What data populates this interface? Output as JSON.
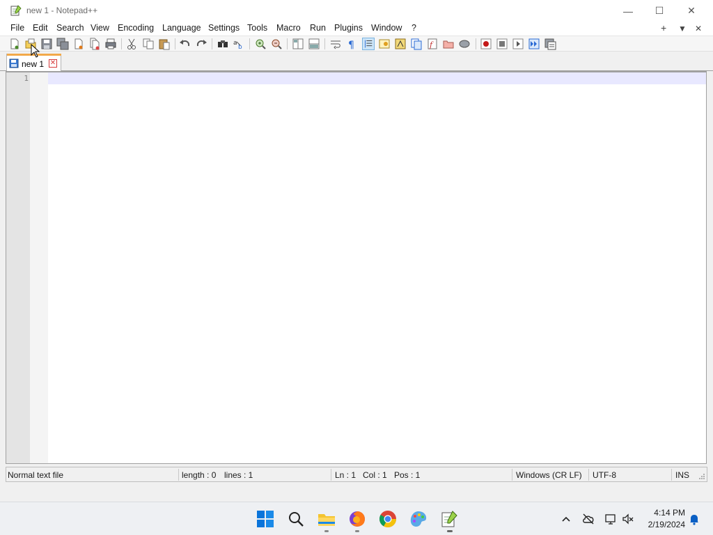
{
  "window": {
    "title": "new 1 - Notepad++",
    "controls": {
      "minimize": "—",
      "maximize": "☐",
      "close": "✕"
    }
  },
  "menu": {
    "items": [
      "File",
      "Edit",
      "Search",
      "View",
      "Encoding",
      "Language",
      "Settings",
      "Tools",
      "Macro",
      "Run",
      "Plugins",
      "Window",
      "?"
    ],
    "right": {
      "add": "+",
      "list": "▼",
      "close": "✕"
    }
  },
  "toolbar": {
    "icons": [
      "new-file-icon",
      "open-file-icon",
      "save-icon",
      "save-all-icon",
      "close-icon",
      "close-all-icon",
      "print-icon",
      "cut-icon",
      "copy-icon",
      "paste-icon",
      "undo-icon",
      "redo-icon",
      "find-icon",
      "replace-icon",
      "zoom-in-icon",
      "zoom-out-icon",
      "sync-vertical-icon",
      "sync-horizontal-icon",
      "word-wrap-icon",
      "show-all-characters-icon",
      "indent-guide-icon",
      "user-defined-language-icon",
      "document-map-icon",
      "document-list-icon",
      "function-list-icon",
      "folder-as-workspace-icon",
      "monitoring-icon",
      "macro-record-icon",
      "macro-stop-icon",
      "macro-play-icon",
      "macro-run-multiple-icon",
      "macro-save-icon"
    ]
  },
  "tabs": [
    {
      "label": "new 1",
      "active": true,
      "close_glyph": "✕"
    }
  ],
  "editor": {
    "line_numbers": [
      "1"
    ],
    "content": "",
    "current_line_color": "#e8e8ff"
  },
  "status": {
    "file_type": "Normal text file",
    "length": "length : 0",
    "lines": "lines : 1",
    "ln": "Ln : 1",
    "col": "Col : 1",
    "pos": "Pos : 1",
    "eol": "Windows (CR LF)",
    "encoding": "UTF-8",
    "mode": "INS"
  },
  "taskbar": {
    "apps": [
      "windows-start-icon",
      "search-icon",
      "file-explorer-icon",
      "firefox-icon",
      "chrome-icon",
      "paint-icon",
      "notepad-plus-plus-icon"
    ],
    "tray": [
      "chevron-up-icon",
      "cloud-offline-icon",
      "network-icon",
      "volume-muted-icon"
    ],
    "time": "4:14 PM",
    "date": "2/19/2024",
    "notification": "bell-icon"
  },
  "colors": {
    "tab_accent": "#f2a94a",
    "tab_close": "#d63a3a",
    "win11_blue": "#0078d4"
  }
}
